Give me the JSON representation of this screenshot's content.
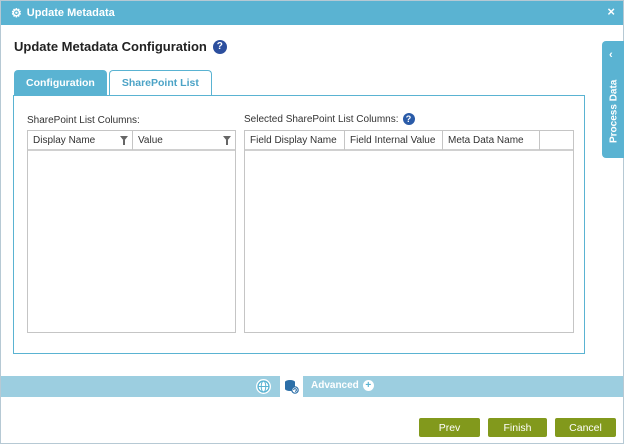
{
  "window": {
    "title": "Update Metadata",
    "close_glyph": "×"
  },
  "page": {
    "title": "Update Metadata Configuration"
  },
  "tabs": [
    {
      "label": "Configuration",
      "active": false
    },
    {
      "label": "SharePoint List",
      "active": true
    }
  ],
  "left_section": {
    "label": "SharePoint List Columns:",
    "columns": [
      "Display Name",
      "Value"
    ],
    "rows": []
  },
  "right_section": {
    "label": "Selected SharePoint List Columns:",
    "columns": [
      "Field Display Name",
      "Field Internal Value",
      "Meta Data Name"
    ],
    "rows": []
  },
  "side_panel": {
    "label": "Process Data",
    "chevron": "‹"
  },
  "bottom_bar": {
    "advanced_label": "Advanced",
    "plus_glyph": "+"
  },
  "buttons": {
    "prev": "Prev",
    "finish": "Finish",
    "cancel": "Cancel"
  },
  "help_glyph": "?",
  "colors": {
    "accent": "#5ab3d2",
    "button_green": "#82991c",
    "help_blue": "#2c4f9e",
    "bottom_bar": "#9ccee0"
  },
  "icons": {
    "titlebar": "gear-icon",
    "close": "close-icon",
    "help": "help-icon",
    "filter": "filter-icon",
    "globe": "globe-icon",
    "database": "database-icon"
  }
}
